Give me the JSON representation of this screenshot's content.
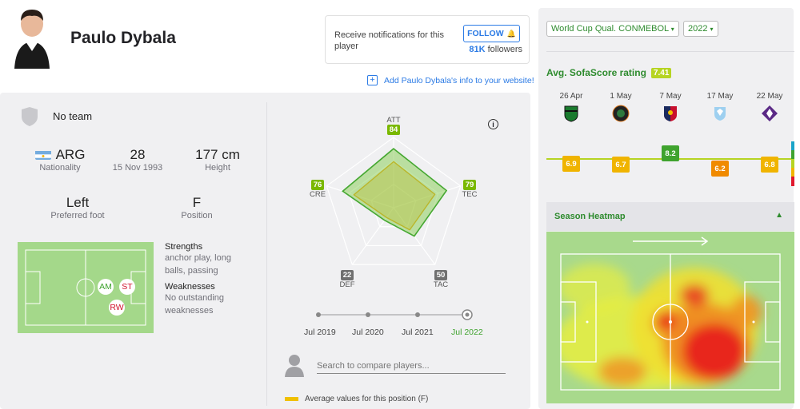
{
  "player": {
    "name": "Paulo Dybala",
    "team": "No team",
    "nationality_code": "ARG",
    "nationality_label": "Nationality",
    "age": "28",
    "birth_date": "15 Nov 1993",
    "height": "177 cm",
    "height_label": "Height",
    "preferred_foot": "Left",
    "preferred_foot_label": "Preferred foot",
    "position": "F",
    "position_label": "Position",
    "positions_on_pitch": [
      "AM",
      "ST",
      "RW"
    ],
    "strengths_label": "Strengths",
    "strengths": "anchor play, long balls, passing",
    "weaknesses_label": "Weaknesses",
    "weaknesses": "No outstanding weaknesses"
  },
  "notifications": {
    "text": "Receive notifications for this player",
    "follow_label": "FOLLOW",
    "followers_count": "81K",
    "followers_label": "followers"
  },
  "add_info_link": "Add Paulo Dybala's info to your website!",
  "attributes": {
    "ATT": {
      "label": "ATT",
      "value": 84,
      "color": "#7ab800"
    },
    "TEC": {
      "label": "TEC",
      "value": 79,
      "color": "#7ab800"
    },
    "TAC": {
      "label": "TAC",
      "value": 50,
      "color": "#707070"
    },
    "DEF": {
      "label": "DEF",
      "value": 22,
      "color": "#707070"
    },
    "CRE": {
      "label": "CRE",
      "value": 76,
      "color": "#7ab800"
    }
  },
  "timeline": {
    "labels": [
      "Jul 2019",
      "Jul 2020",
      "Jul 2021",
      "Jul 2022"
    ],
    "selected_index": 3
  },
  "compare": {
    "placeholder": "Search to compare players..."
  },
  "average_legend": "Average values for this position (F)",
  "filters": {
    "competition": "World Cup Qual. CONMEBOL",
    "season": "2022"
  },
  "rating": {
    "title": "Avg. SofaScore rating",
    "average": "7.41",
    "matches": [
      {
        "date": "26 Apr",
        "club": "sassuolo-logo",
        "rating": "6.9",
        "color": "#f0b400"
      },
      {
        "date": "1 May",
        "club": "venezia-logo",
        "rating": "6.7",
        "color": "#f0b400"
      },
      {
        "date": "7 May",
        "club": "genoa-logo",
        "rating": "8.2",
        "color": "#3fa32e"
      },
      {
        "date": "17 May",
        "club": "lazio-logo",
        "rating": "6.2",
        "color": "#f08a00"
      },
      {
        "date": "22 May",
        "club": "fiorentina-logo",
        "rating": "6.8",
        "color": "#f0b400"
      }
    ]
  },
  "heatmap": {
    "title": "Season Heatmap"
  },
  "colors": {
    "accent_blue": "#2c7be5",
    "accent_green": "#2e8b2e",
    "pitch_green": "#a8d98c"
  }
}
